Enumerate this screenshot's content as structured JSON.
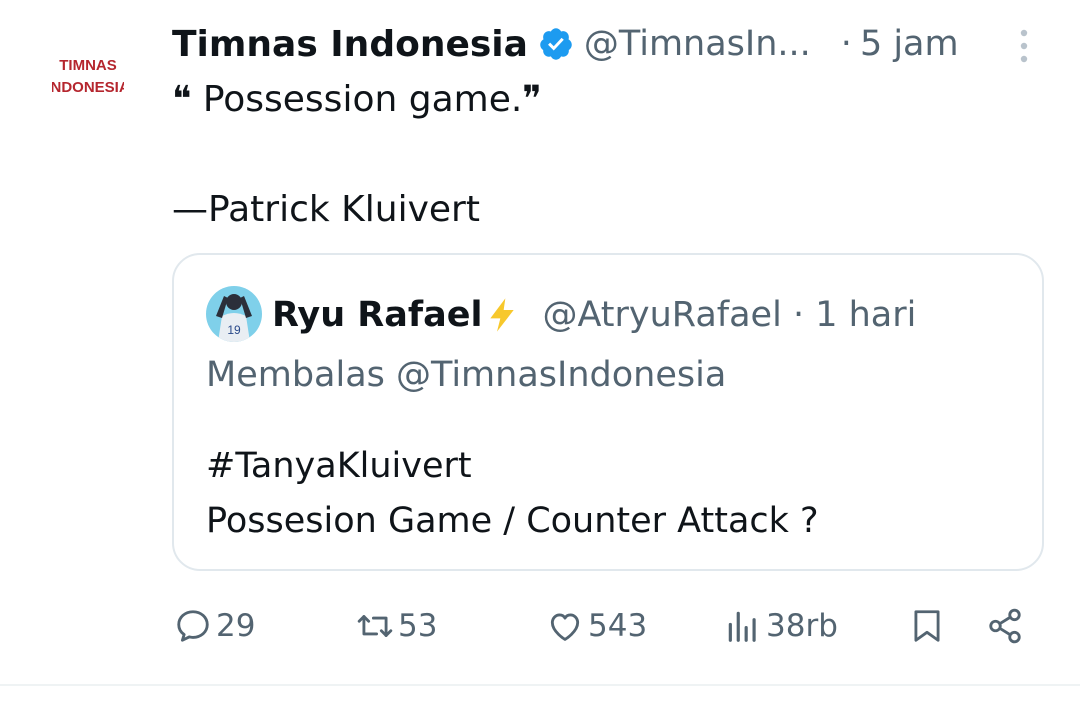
{
  "tweet": {
    "author_name": "Timnas Indonesia",
    "author_handle": "@TimnasIn...",
    "time_dot": "·",
    "time": "5 jam",
    "avatar_logo_text": [
      "TIMNAS",
      "INDONESIA"
    ],
    "text_line1": "❝ Possession game.❞",
    "text_line2": "—Patrick Kluivert"
  },
  "quote": {
    "author_name": "Ryu Rafael",
    "author_handle": "@AtryuRafael · 1 hari",
    "reply_to": "Membalas @TimnasIndonesia",
    "hashtag": "#TanyaKluivert",
    "text": "Possesion Game / Counter Attack ?",
    "avatar_jersey_number": "19"
  },
  "actions": {
    "replies": "29",
    "retweets": "53",
    "likes": "543",
    "views": "38rb"
  },
  "icons": {
    "verified": "verified-badge-icon",
    "more": "more-vertical-icon",
    "bolt": "lightning-icon",
    "reply": "reply-icon",
    "retweet": "retweet-icon",
    "like": "heart-icon",
    "views": "views-chart-icon",
    "bookmark": "bookmark-icon",
    "share": "share-icon"
  },
  "colors": {
    "brand_red": "#b5262e",
    "verified_blue": "#1d9bf0",
    "secondary_text": "#536471",
    "bolt_yellow": "#f7c82c"
  }
}
